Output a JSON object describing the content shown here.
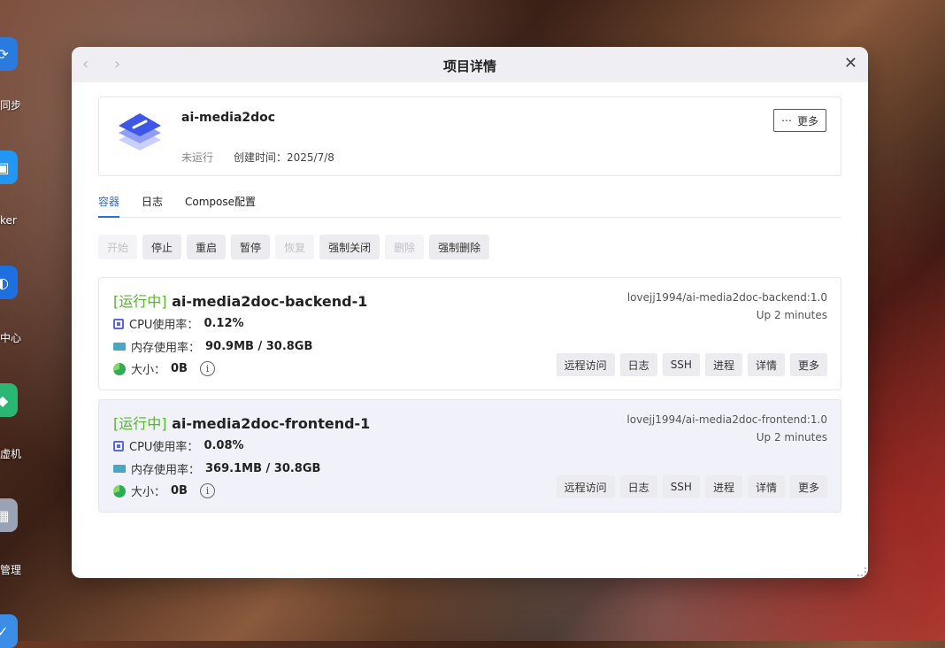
{
  "desktop": {
    "labels": [
      "同步",
      "ker",
      "中心",
      "虚机",
      "管理"
    ]
  },
  "window": {
    "title": "项目详情",
    "back_icon": "‹",
    "forward_icon": "›",
    "close_icon": "✕"
  },
  "project": {
    "name": "ai-media2doc",
    "status": "未运行",
    "created": "创建时间：2025/7/8",
    "more_label": "更多",
    "more_icon": "⋯"
  },
  "tabs": [
    {
      "label": "容器",
      "active": true
    },
    {
      "label": "日志",
      "active": false
    },
    {
      "label": "Compose配置",
      "active": false
    }
  ],
  "actions": [
    {
      "label": "开始",
      "enabled": false
    },
    {
      "label": "停止",
      "enabled": true
    },
    {
      "label": "重启",
      "enabled": true
    },
    {
      "label": "暂停",
      "enabled": true
    },
    {
      "label": "恢复",
      "enabled": false
    },
    {
      "label": "强制关闭",
      "enabled": true
    },
    {
      "label": "删除",
      "enabled": false
    },
    {
      "label": "强制删除",
      "enabled": true
    }
  ],
  "containers": [
    {
      "state": "[运行中]",
      "name": "ai-media2doc-backend-1",
      "cpu_label": "CPU使用率：",
      "cpu_value": "0.12%",
      "mem_label": "内存使用率：",
      "mem_value": "90.9MB / 30.8GB",
      "size_label": "大小：",
      "size_value": "0B",
      "image": "lovejj1994/ai-media2doc-backend:1.0",
      "uptime": "Up 2 minutes",
      "buttons": [
        "远程访问",
        "日志",
        "SSH",
        "进程",
        "详情",
        "更多"
      ],
      "highlighted": false
    },
    {
      "state": "[运行中]",
      "name": "ai-media2doc-frontend-1",
      "cpu_label": "CPU使用率：",
      "cpu_value": "0.08%",
      "mem_label": "内存使用率：",
      "mem_value": "369.1MB / 30.8GB",
      "size_label": "大小：",
      "size_value": "0B",
      "image": "lovejj1994/ai-media2doc-frontend:1.0",
      "uptime": "Up 2 minutes",
      "buttons": [
        "远程访问",
        "日志",
        "SSH",
        "进程",
        "详情",
        "更多"
      ],
      "highlighted": true
    }
  ],
  "colors": {
    "accent": "#2f6bd8",
    "running": "#55b52e",
    "hover_bg": "#f1f2f9"
  }
}
